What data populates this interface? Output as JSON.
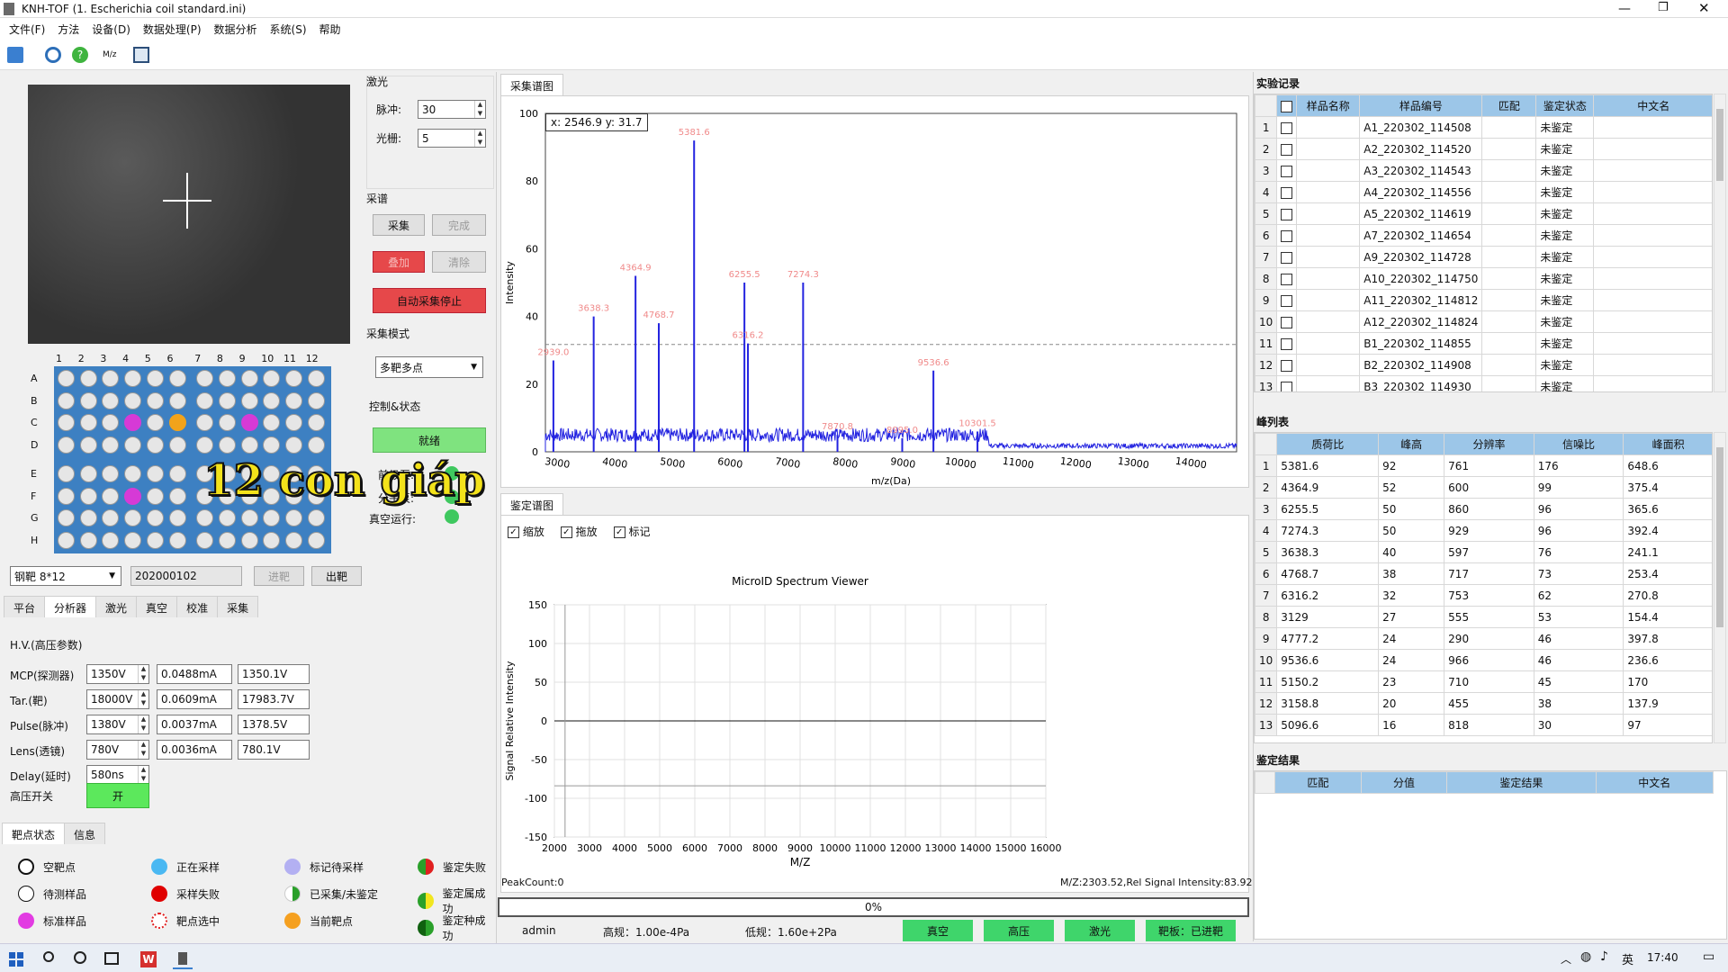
{
  "window": {
    "title": "KNH-TOF (1. Escherichia coil standard.ini)"
  },
  "menu": [
    "文件(F)",
    "方法",
    "设备(D)",
    "数据处理(P)",
    "数据分析",
    "系统(S)",
    "帮助"
  ],
  "toolbar_icons": [
    "open-folder-icon",
    "settings-icon",
    "help-icon",
    "mz-icon",
    "screenshot-icon"
  ],
  "camera": {
    "overlay_text": "12 con giáp"
  },
  "plate": {
    "cols": [
      "1",
      "2",
      "3",
      "4",
      "5",
      "6",
      "7",
      "8",
      "9",
      "10",
      "11",
      "12"
    ],
    "rows": [
      "A",
      "B",
      "C",
      "D",
      "E",
      "F",
      "G",
      "H"
    ],
    "highlight": [
      {
        "row": 2,
        "col": 3,
        "color": "#d63ad6"
      },
      {
        "row": 2,
        "col": 5,
        "color": "#f2a31b"
      },
      {
        "row": 2,
        "col": 8,
        "color": "#d63ad6"
      },
      {
        "row": 5,
        "col": 3,
        "color": "#d63ad6"
      }
    ],
    "type_select": "钢靶 8*12",
    "plate_id": "202000102",
    "btn_in": "进靶",
    "btn_out": "出靶"
  },
  "laser": {
    "title": "激光",
    "pulse_label": "脉冲:",
    "pulse_value": "30",
    "aperture_label": "光栅:",
    "aperture_value": "5"
  },
  "acquire": {
    "title": "采谱",
    "btn_acquire": "采集",
    "btn_done": "完成",
    "btn_add": "叠加",
    "btn_clear": "清除",
    "btn_auto_stop": "自动采集停止"
  },
  "mode": {
    "title": "采集模式",
    "value": "多靶多点"
  },
  "control": {
    "title": "控制&状态",
    "btn_ready": "就绪",
    "label_pre": "前级泵:",
    "label_mol": "分子泵:",
    "label_vac": "真空运行:"
  },
  "left_tabs": [
    "平台",
    "分析器",
    "激光",
    "真空",
    "校准",
    "采集"
  ],
  "hv": {
    "title": "H.V.(高压参数)",
    "rows": [
      {
        "label": "MCP(探测器)",
        "set": "1350V",
        "current": "0.0488mA",
        "read": "1350.1V"
      },
      {
        "label": "Tar.(靶)",
        "set": "18000V",
        "current": "0.0609mA",
        "read": "17983.7V"
      },
      {
        "label": "Pulse(脉冲)",
        "set": "1380V",
        "current": "0.0037mA",
        "read": "1378.5V"
      },
      {
        "label": "Lens(透镜)",
        "set": "780V",
        "current": "0.0036mA",
        "read": "780.1V"
      },
      {
        "label": "Delay(延时)",
        "set": "580ns",
        "current": "",
        "read": ""
      }
    ],
    "switch_label": "高压开关",
    "switch_btn": "开"
  },
  "bottom_tabs": [
    "靶点状态",
    "信息"
  ],
  "legend": [
    {
      "label": "空靶点",
      "style": "empty"
    },
    {
      "label": "正在采样",
      "style": "sampling"
    },
    {
      "label": "标记待采样",
      "style": "marked"
    },
    {
      "label": "鉴定失败",
      "style": "fail"
    },
    {
      "label": "待测样品",
      "style": "pending"
    },
    {
      "label": "采样失败",
      "style": "samplefail"
    },
    {
      "label": "已采集/未鉴定",
      "style": "collected"
    },
    {
      "label": "鉴定属成功",
      "style": "genus"
    },
    {
      "label": "标准样品",
      "style": "standard"
    },
    {
      "label": "靶点选中",
      "style": "selected"
    },
    {
      "label": "当前靶点",
      "style": "current"
    },
    {
      "label": "鉴定种成功",
      "style": "species"
    }
  ],
  "spectrum": {
    "tab": "采集谱图",
    "cursor": "x: 2546.9  y: 31.7",
    "ylabel": "Intensity",
    "xlabel": "m/z(Da)",
    "yticks": [
      "0",
      "20",
      "40",
      "60",
      "80",
      "100"
    ],
    "xticks": [
      "3000",
      "4000",
      "5000",
      "6000",
      "7000",
      "8000",
      "9000",
      "10000",
      "11000",
      "12000",
      "13000",
      "14000"
    ]
  },
  "chart_data": [
    {
      "type": "line",
      "title": "",
      "xlabel": "m/z(Da)",
      "ylabel": "Intensity",
      "xlim": [
        2800,
        14800
      ],
      "ylim": [
        0,
        100
      ],
      "threshold": 31.7,
      "peaks": [
        {
          "x": 2939.0,
          "y": 27,
          "label": "2939.0"
        },
        {
          "x": 3638.3,
          "y": 40,
          "label": "3638.3"
        },
        {
          "x": 4364.9,
          "y": 52,
          "label": "4364.9"
        },
        {
          "x": 4768.7,
          "y": 38,
          "label": "4768.7"
        },
        {
          "x": 5381.6,
          "y": 92,
          "label": "5381.6"
        },
        {
          "x": 6255.5,
          "y": 50,
          "label": "6255.5"
        },
        {
          "x": 6316.2,
          "y": 32,
          "label": "6316.2"
        },
        {
          "x": 7274.3,
          "y": 50,
          "label": "7274.3"
        },
        {
          "x": 7870.8,
          "y": 5,
          "label": "7870.8"
        },
        {
          "x": 8995.0,
          "y": 4,
          "label": "8995.0"
        },
        {
          "x": 9536.6,
          "y": 24,
          "label": "9536.6"
        },
        {
          "x": 10301.5,
          "y": 6,
          "label": "10301.5"
        }
      ]
    },
    {
      "type": "line",
      "title": "MicroID Spectrum Viewer",
      "xlabel": "M/Z",
      "ylabel": "Signal Relative Intensity",
      "xlim": [
        2000,
        16000
      ],
      "ylim": [
        -150,
        150
      ],
      "xticks": [
        "2000",
        "3000",
        "4000",
        "5000",
        "6000",
        "7000",
        "8000",
        "9000",
        "10000",
        "11000",
        "12000",
        "13000",
        "14000",
        "15000",
        "16000"
      ],
      "yticks": [
        "150",
        "100",
        "50",
        "0",
        "-50",
        "-100",
        "-150"
      ],
      "cursor_x": 2303.52,
      "cursor_y": -83.92
    }
  ],
  "ident": {
    "tab": "鉴定谱图",
    "cb_zoom": "缩放",
    "cb_drag": "拖放",
    "cb_mark": "标记",
    "peakcount": "PeakCount:0",
    "readout": "M/Z:2303.52,Rel Signal Intensity:83.92"
  },
  "progress": {
    "text": "0%",
    "value": 0
  },
  "statusbar": {
    "user": "admin",
    "high": "高规：1.00e-4Pa",
    "low": "低规：1.60e+2Pa",
    "cells": [
      "真空",
      "高压",
      "激光",
      "靶板：已进靶"
    ]
  },
  "records": {
    "title": "实验记录",
    "headers": [
      "样品名称",
      "样品编号",
      "匹配",
      "鉴定状态",
      "中文名"
    ],
    "rows": [
      [
        "1",
        "A1_220302_114508",
        "未鉴定"
      ],
      [
        "2",
        "A2_220302_114520",
        "未鉴定"
      ],
      [
        "3",
        "A3_220302_114543",
        "未鉴定"
      ],
      [
        "4",
        "A4_220302_114556",
        "未鉴定"
      ],
      [
        "5",
        "A5_220302_114619",
        "未鉴定"
      ],
      [
        "6",
        "A7_220302_114654",
        "未鉴定"
      ],
      [
        "7",
        "A9_220302_114728",
        "未鉴定"
      ],
      [
        "8",
        "A10_220302_114750",
        "未鉴定"
      ],
      [
        "9",
        "A11_220302_114812",
        "未鉴定"
      ],
      [
        "10",
        "A12_220302_114824",
        "未鉴定"
      ],
      [
        "11",
        "B1_220302_114855",
        "未鉴定"
      ],
      [
        "12",
        "B2_220302_114908",
        "未鉴定"
      ],
      [
        "13",
        "B3_220302_114930",
        "未鉴定"
      ]
    ]
  },
  "peaks": {
    "title": "峰列表",
    "headers": [
      "质荷比",
      "峰高",
      "分辨率",
      "信噪比",
      "峰面积"
    ],
    "rows": [
      [
        "1",
        "5381.6",
        "92",
        "761",
        "176",
        "648.6"
      ],
      [
        "2",
        "4364.9",
        "52",
        "600",
        "99",
        "375.4"
      ],
      [
        "3",
        "6255.5",
        "50",
        "860",
        "96",
        "365.6"
      ],
      [
        "4",
        "7274.3",
        "50",
        "929",
        "96",
        "392.4"
      ],
      [
        "5",
        "3638.3",
        "40",
        "597",
        "76",
        "241.1"
      ],
      [
        "6",
        "4768.7",
        "38",
        "717",
        "73",
        "253.4"
      ],
      [
        "7",
        "6316.2",
        "32",
        "753",
        "62",
        "270.8"
      ],
      [
        "8",
        "3129",
        "27",
        "555",
        "53",
        "154.4"
      ],
      [
        "9",
        "4777.2",
        "24",
        "290",
        "46",
        "397.8"
      ],
      [
        "10",
        "9536.6",
        "24",
        "966",
        "46",
        "236.6"
      ],
      [
        "11",
        "5150.2",
        "23",
        "710",
        "45",
        "170"
      ],
      [
        "12",
        "3158.8",
        "20",
        "455",
        "38",
        "137.9"
      ],
      [
        "13",
        "5096.6",
        "16",
        "818",
        "30",
        "97"
      ]
    ]
  },
  "result": {
    "title": "鉴定结果",
    "headers": [
      "匹配",
      "分值",
      "鉴定结果",
      "中文名"
    ]
  },
  "taskbar": {
    "clock": "17:40",
    "lang": "英"
  }
}
